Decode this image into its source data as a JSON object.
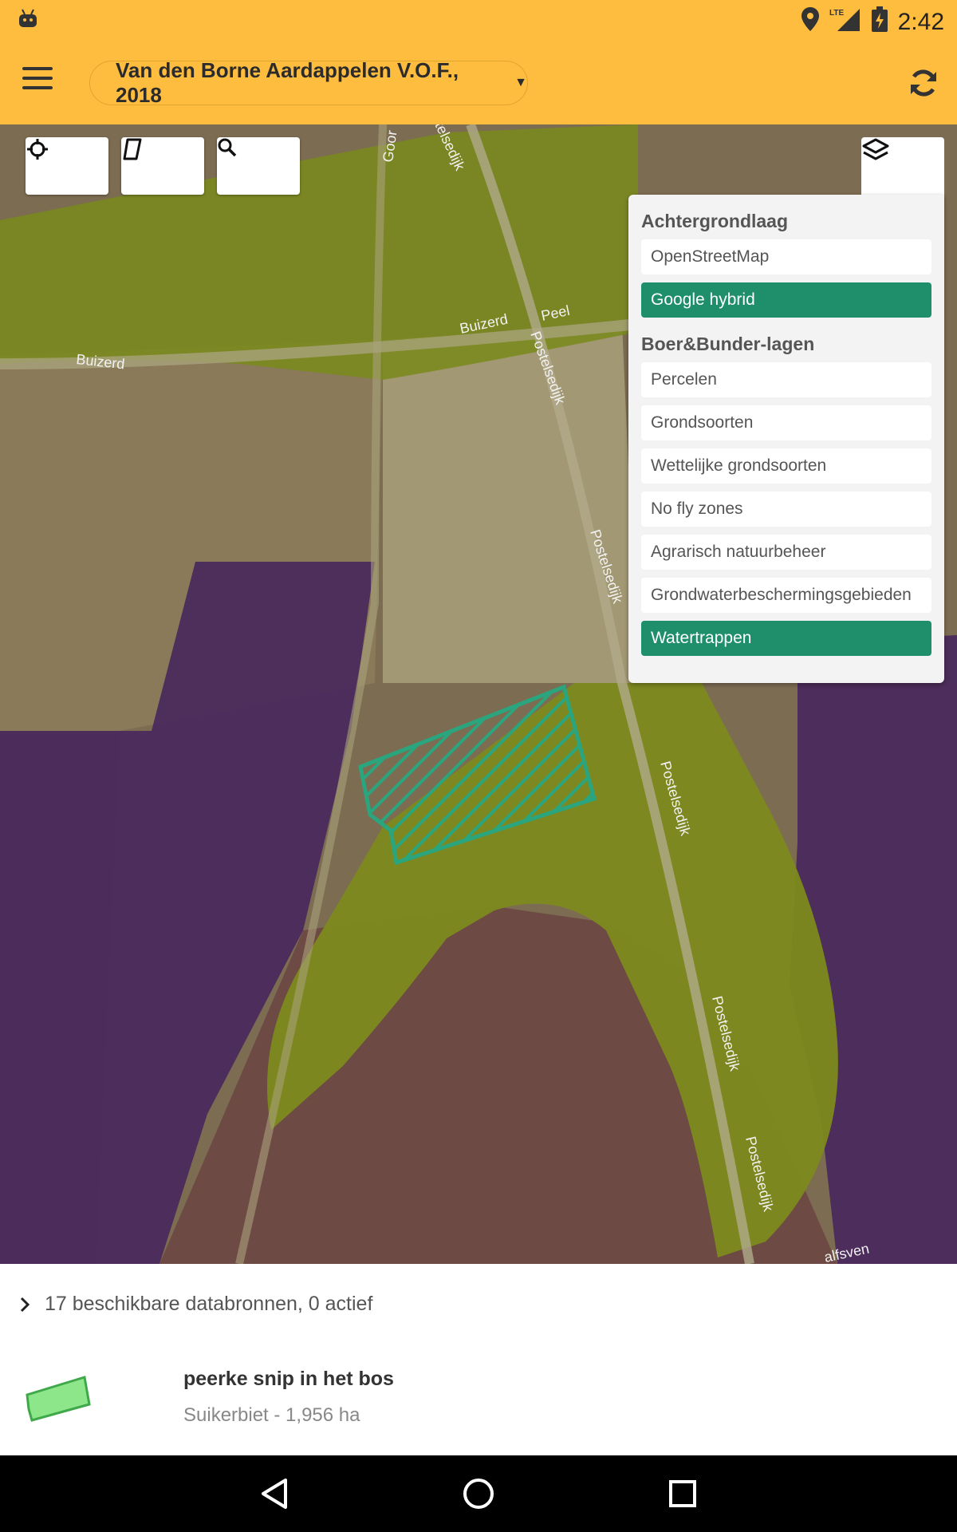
{
  "status_bar": {
    "time": "2:42",
    "network": "LTE"
  },
  "app_bar": {
    "farm_selector": "Van den Borne Aardappelen V.O.F., 2018"
  },
  "map": {
    "road_labels": [
      "Buizerd",
      "Buizerd",
      "Peel",
      "Postelsedijk",
      "Postelsedijk",
      "Postelsedijk",
      "Postelsedijk",
      "Postelsedijk",
      "telsedijk",
      "Goor",
      "alfsven"
    ]
  },
  "layer_panel": {
    "background_heading": "Achtergrondlaag",
    "background_layers": [
      {
        "label": "OpenStreetMap",
        "active": false
      },
      {
        "label": "Google hybrid",
        "active": true
      }
    ],
    "bb_heading": "Boer&Bunder-lagen",
    "bb_layers": [
      {
        "label": "Percelen",
        "active": false
      },
      {
        "label": "Grondsoorten",
        "active": false
      },
      {
        "label": "Wettelijke grondsoorten",
        "active": false
      },
      {
        "label": "No fly zones",
        "active": false
      },
      {
        "label": "Agrarisch natuurbeheer",
        "active": false
      },
      {
        "label": "Grondwaterbeschermingsgebieden",
        "active": false
      },
      {
        "label": "Watertrappen",
        "active": true
      }
    ]
  },
  "bottom_sheet": {
    "datasources": "17 beschikbare databronnen, 0 actief",
    "parcel": {
      "name": "peerke snip in het bos",
      "details": "Suikerbiet - 1,956 ha"
    }
  },
  "colors": {
    "accent": "#ffbd3f",
    "active_layer": "#1e8f6a",
    "parcel_fill": "#8ee68a"
  }
}
